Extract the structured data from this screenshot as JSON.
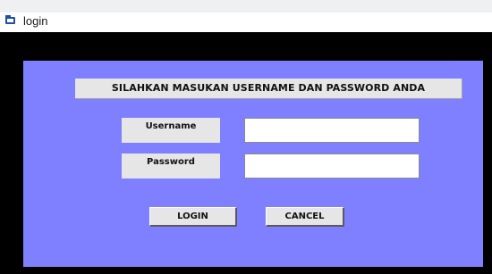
{
  "window": {
    "title": "login",
    "icon": "app-window-icon"
  },
  "form": {
    "header": "SILAHKAN MASUKAN USERNAME DAN PASSWORD ANDA",
    "username_label": "Username",
    "username_value": "",
    "password_label": "Password",
    "password_value": ""
  },
  "buttons": {
    "login_label": "LOGIN",
    "cancel_label": "CANCEL"
  },
  "colors": {
    "panel_background": "#7f80ff",
    "window_background": "#000000",
    "control_face": "#e6e6e6"
  }
}
